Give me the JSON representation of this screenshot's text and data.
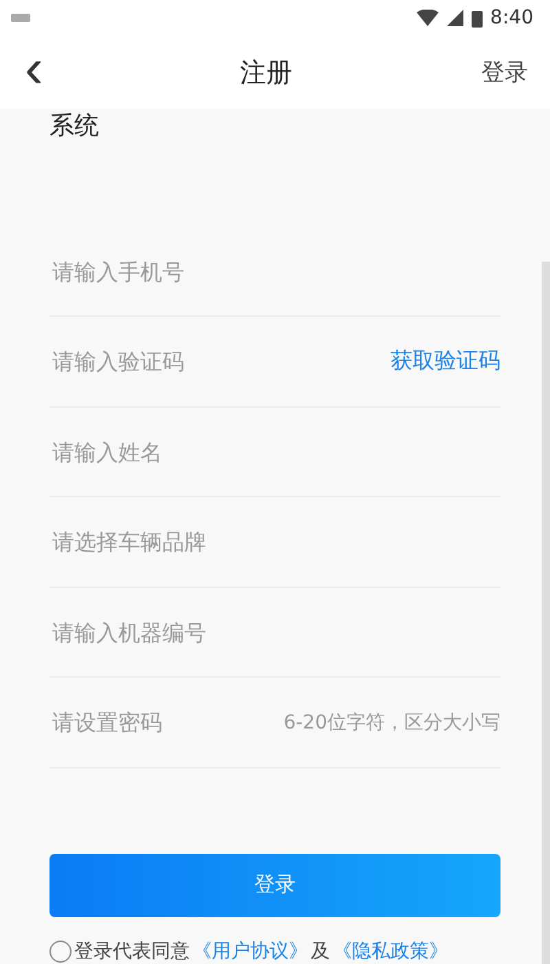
{
  "status_bar": {
    "time": "8:40"
  },
  "header": {
    "back": "‹",
    "title": "注册",
    "action": "登录"
  },
  "section_title": "系统",
  "fields": [
    {
      "kind": "plain",
      "placeholder": "请输入手机号"
    },
    {
      "kind": "code",
      "placeholder": "请输入验证码",
      "action": "获取验证码"
    },
    {
      "kind": "plain",
      "placeholder": "请输入姓名"
    },
    {
      "kind": "plain",
      "placeholder": "请选择车辆品牌"
    },
    {
      "kind": "plain",
      "placeholder": "请输入机器编号"
    },
    {
      "kind": "hint",
      "placeholder": "请设置密码",
      "hint": "6-20位字符，区分大小写"
    }
  ],
  "submit": "登录",
  "agreement": {
    "checked": false,
    "text": "登录代表同意",
    "link1": "《用户协议》",
    "joiner": "及",
    "link2": "《隐私政策》"
  }
}
